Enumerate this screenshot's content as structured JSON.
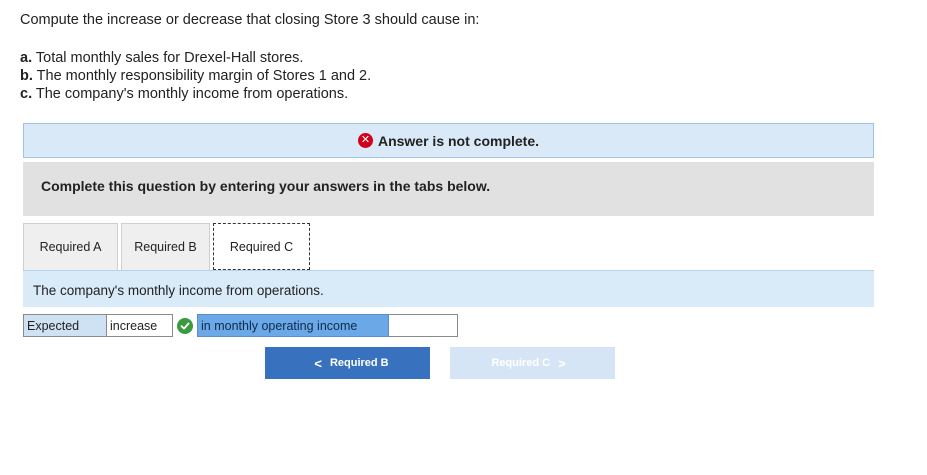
{
  "question": {
    "intro": "Compute the increase or decrease that closing Store 3 should cause in:",
    "parts": [
      {
        "letter": "a.",
        "text": "Total monthly sales for Drexel-Hall stores."
      },
      {
        "letter": "b.",
        "text": "The monthly responsibility margin of Stores 1 and 2."
      },
      {
        "letter": "c.",
        "text": "The company's monthly income from operations."
      }
    ]
  },
  "banner": {
    "status_text": "Answer is not complete."
  },
  "instructions": "Complete this question by entering your answers in the tabs below.",
  "tabs": [
    {
      "label": "Required A"
    },
    {
      "label": "Required B"
    },
    {
      "label": "Required C"
    }
  ],
  "active_tab": "Required C",
  "tab_content": {
    "prompt": "The company's monthly income from operations.",
    "row": {
      "label": "Expected",
      "selected_value": "increase",
      "description": "in monthly operating income",
      "amount": ""
    }
  },
  "navigation": {
    "prev_label": "Required B",
    "next_label": "Required C"
  },
  "colors": {
    "error": "#d0021b",
    "correct": "#3a9a3f",
    "primary_button": "#3872be",
    "disabled_button": "#d6e5f6",
    "banner_bg": "#d9e9f7"
  }
}
